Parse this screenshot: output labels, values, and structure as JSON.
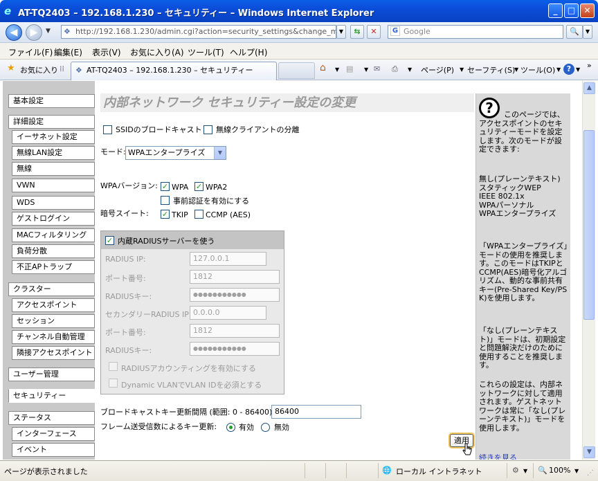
{
  "window": {
    "title": "AT-TQ2403 – 192.168.1.230 – セキュリティー – Windows Internet Explorer",
    "ie_icon": "ie-logo"
  },
  "address": {
    "url": "http://192.168.1.230/admin.cgi?action=security_settings&change_mode_vi",
    "search_placeholder": "Google"
  },
  "menu": [
    "ファイル(F)",
    "編集(E)",
    "表示(V)",
    "お気に入り(A)",
    "ツール(T)",
    "ヘルプ(H)"
  ],
  "favbar": {
    "favorites": "お気に入り",
    "tab_title": "AT-TQ2403 – 192.168.1.230 – セキュリティー",
    "page": "ページ(P)",
    "safety": "セーフティ(S)",
    "tools": "ツール(O)"
  },
  "nav": [
    {
      "label": "基本設定",
      "type": "group"
    },
    {
      "label": "詳細設定",
      "type": "group"
    },
    {
      "label": "イーサネット設定",
      "type": "sub"
    },
    {
      "label": "無線LAN設定",
      "type": "sub"
    },
    {
      "label": "無線",
      "type": "sub"
    },
    {
      "label": "VWN",
      "type": "sub"
    },
    {
      "label": "WDS",
      "type": "sub"
    },
    {
      "label": "ゲストログイン",
      "type": "sub"
    },
    {
      "label": "MACフィルタリング",
      "type": "sub"
    },
    {
      "label": "負荷分散",
      "type": "sub"
    },
    {
      "label": "不正APトラップ",
      "type": "sub"
    },
    {
      "label": "クラスター",
      "type": "group"
    },
    {
      "label": "アクセスポイント",
      "type": "sub"
    },
    {
      "label": "セッション",
      "type": "sub"
    },
    {
      "label": "チャンネル自動管理",
      "type": "sub"
    },
    {
      "label": "隣接アクセスポイント",
      "type": "sub"
    },
    {
      "label": "ユーザー管理",
      "type": "group"
    },
    {
      "label": "セキュリティー",
      "type": "active"
    },
    {
      "label": "ステータス",
      "type": "group"
    },
    {
      "label": "インターフェース",
      "type": "sub"
    },
    {
      "label": "イベント",
      "type": "sub"
    }
  ],
  "main": {
    "title": "内部ネットワーク セキュリティー設定の変更",
    "ssid_broadcast": "SSIDのブロードキャスト",
    "client_isolation": "無線クライアントの分離",
    "mode_label": "モード:",
    "mode_value": "WPAエンタープライズ",
    "wpa_version_label": "WPAバージョン:",
    "wpa": "WPA",
    "wpa2": "WPA2",
    "preauth": "事前認証を有効にする",
    "cipher_label": "暗号スイート:",
    "tkip": "TKIP",
    "ccmp": "CCMP (AES)",
    "radius": {
      "use_internal": "内蔵RADIUSサーバーを使う",
      "ip_label": "RADIUS IP:",
      "ip_value": "127.0.0.1",
      "port_label": "ポート番号:",
      "port_value": "1812",
      "key_label": "RADIUSキー:",
      "key_value": "●●●●●●●●●●●",
      "ip2_label": "セカンダリーRADIUS IP:",
      "ip2_value": "0.0.0.0",
      "port2_label": "ポート番号:",
      "port2_value": "1812",
      "key2_label": "RADIUSキー:",
      "key2_value": "●●●●●●●●●●●",
      "accounting": "RADIUSアカウンティングを有効にする",
      "dynamic_vlan": "Dynamic VLANでVLAN IDを必須とする"
    },
    "rekey_label": "ブロードキャストキー更新間隔 (範囲: 0 - 86400):",
    "rekey_value": "86400",
    "frame_rekey_label": "フレーム送受信数によるキー更新:",
    "enabled": "有効",
    "disabled": "無効",
    "apply": "適用"
  },
  "help": {
    "p1": "このページでは、アクセスポイントのセキュリティーモードを設定します。次のモードが設定できます:",
    "p2": "無し(プレーンテキスト)\nスタティックWEP\nIEEE 802.1x\nWPAパーソナル\nWPAエンタープライズ",
    "p3": "「WPAエンタープライズ」モードの使用を推奨します。このモードはTKIPとCCMP(AES)暗号化アルゴリズム、動的な事前共有キー(Pre-Shared Key/PSK)を使用します。",
    "p4": "「なし(プレーンテキスト)」モードは、初期設定と問題解決だけのために使用することを推奨します。",
    "p5": "これらの設定は、内部ネットワークに対して適用されます。ゲストネットワークは常に「なし(プレーンテキスト)」モードを使用します。",
    "more": "続きを見る"
  },
  "status": {
    "left": "ページが表示されました",
    "zone": "ローカル イントラネット",
    "zoom": "100%"
  }
}
